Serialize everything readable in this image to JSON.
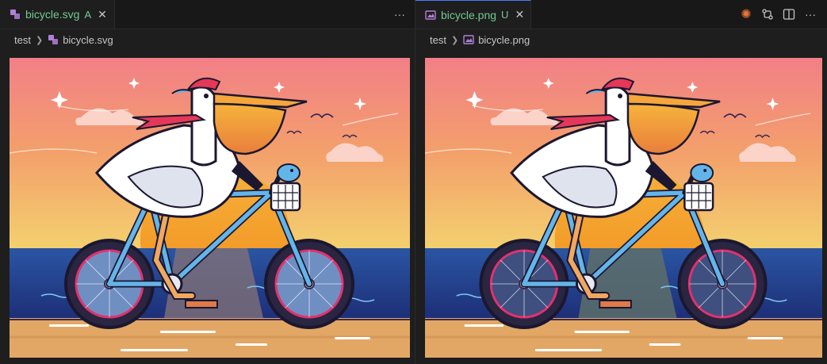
{
  "left_editor": {
    "tab": {
      "filename": "bicycle.svg",
      "status": "A",
      "icon": "svg-file-icon"
    },
    "breadcrumb": {
      "folder": "test",
      "file": "bicycle.svg"
    },
    "actions": [
      "more-actions-icon"
    ],
    "preview": {
      "subject": "pelican-riding-bicycle",
      "format": "svg"
    }
  },
  "right_editor": {
    "tab": {
      "filename": "bicycle.png",
      "status": "U",
      "icon": "image-file-icon"
    },
    "breadcrumb": {
      "folder": "test",
      "file": "bicycle.png"
    },
    "actions": [
      "copilot-sparkle-icon",
      "open-changes-icon",
      "split-editor-icon",
      "more-actions-icon"
    ],
    "preview": {
      "subject": "pelican-riding-bicycle",
      "format": "png"
    }
  },
  "colors": {
    "modified_green": "#73c991",
    "sky_top": "#f27f87",
    "sky_bottom": "#f3d06e",
    "sea": "#213f8c",
    "sand": "#e3a765",
    "bike_frame": "#63b5e9",
    "wheel_rim": "#e0326f"
  }
}
